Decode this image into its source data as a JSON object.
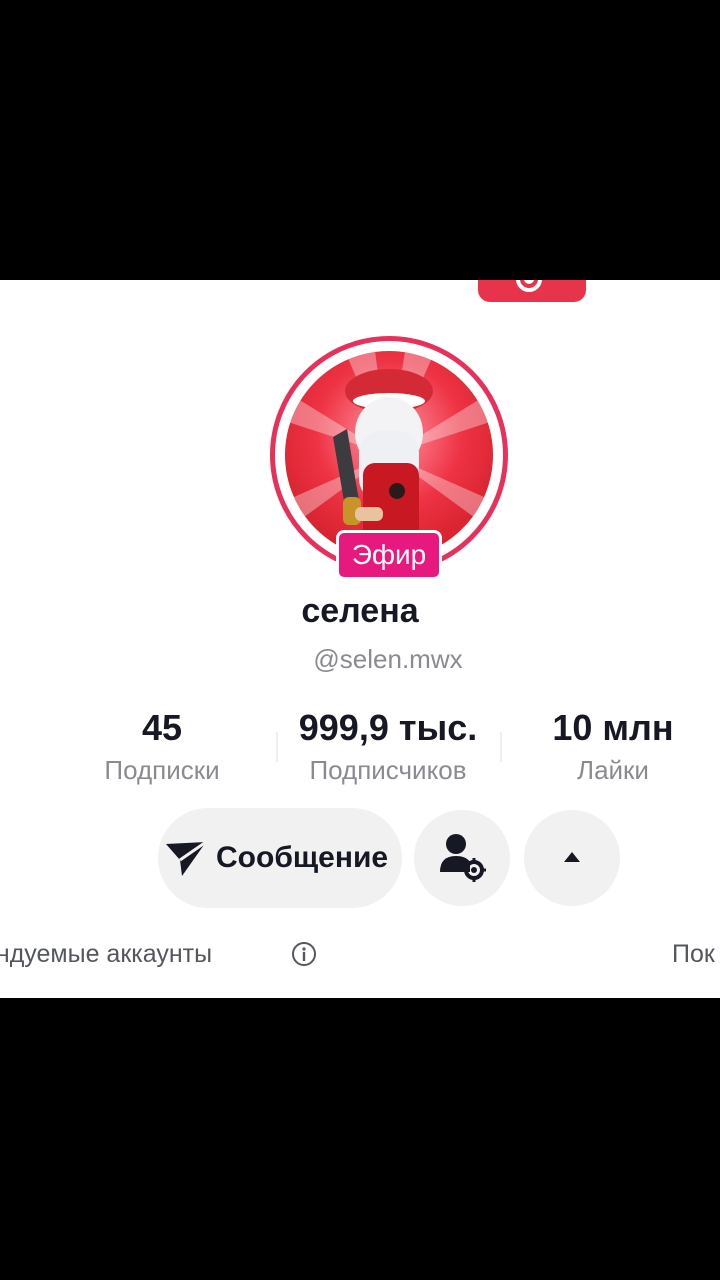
{
  "profile": {
    "display_name": "селена",
    "username": "@selen.mwx",
    "live_badge": "Эфир"
  },
  "stats": {
    "following": {
      "value": "45",
      "label": "Подписки"
    },
    "followers": {
      "value": "999,9 тыс.",
      "label": "Подписчиков"
    },
    "likes": {
      "value": "10 млн",
      "label": "Лайки"
    }
  },
  "actions": {
    "message_label": "Сообщение",
    "user_settings_icon": "user-gear-icon",
    "more_icon": "caret-up-icon"
  },
  "suggested": {
    "label": "ендуемые аккаунты",
    "show_all": "Пок"
  },
  "colors": {
    "accent": "#e8315a",
    "live_badge": "#e8197e",
    "text_primary": "#161823",
    "text_secondary": "#8a8b91"
  }
}
